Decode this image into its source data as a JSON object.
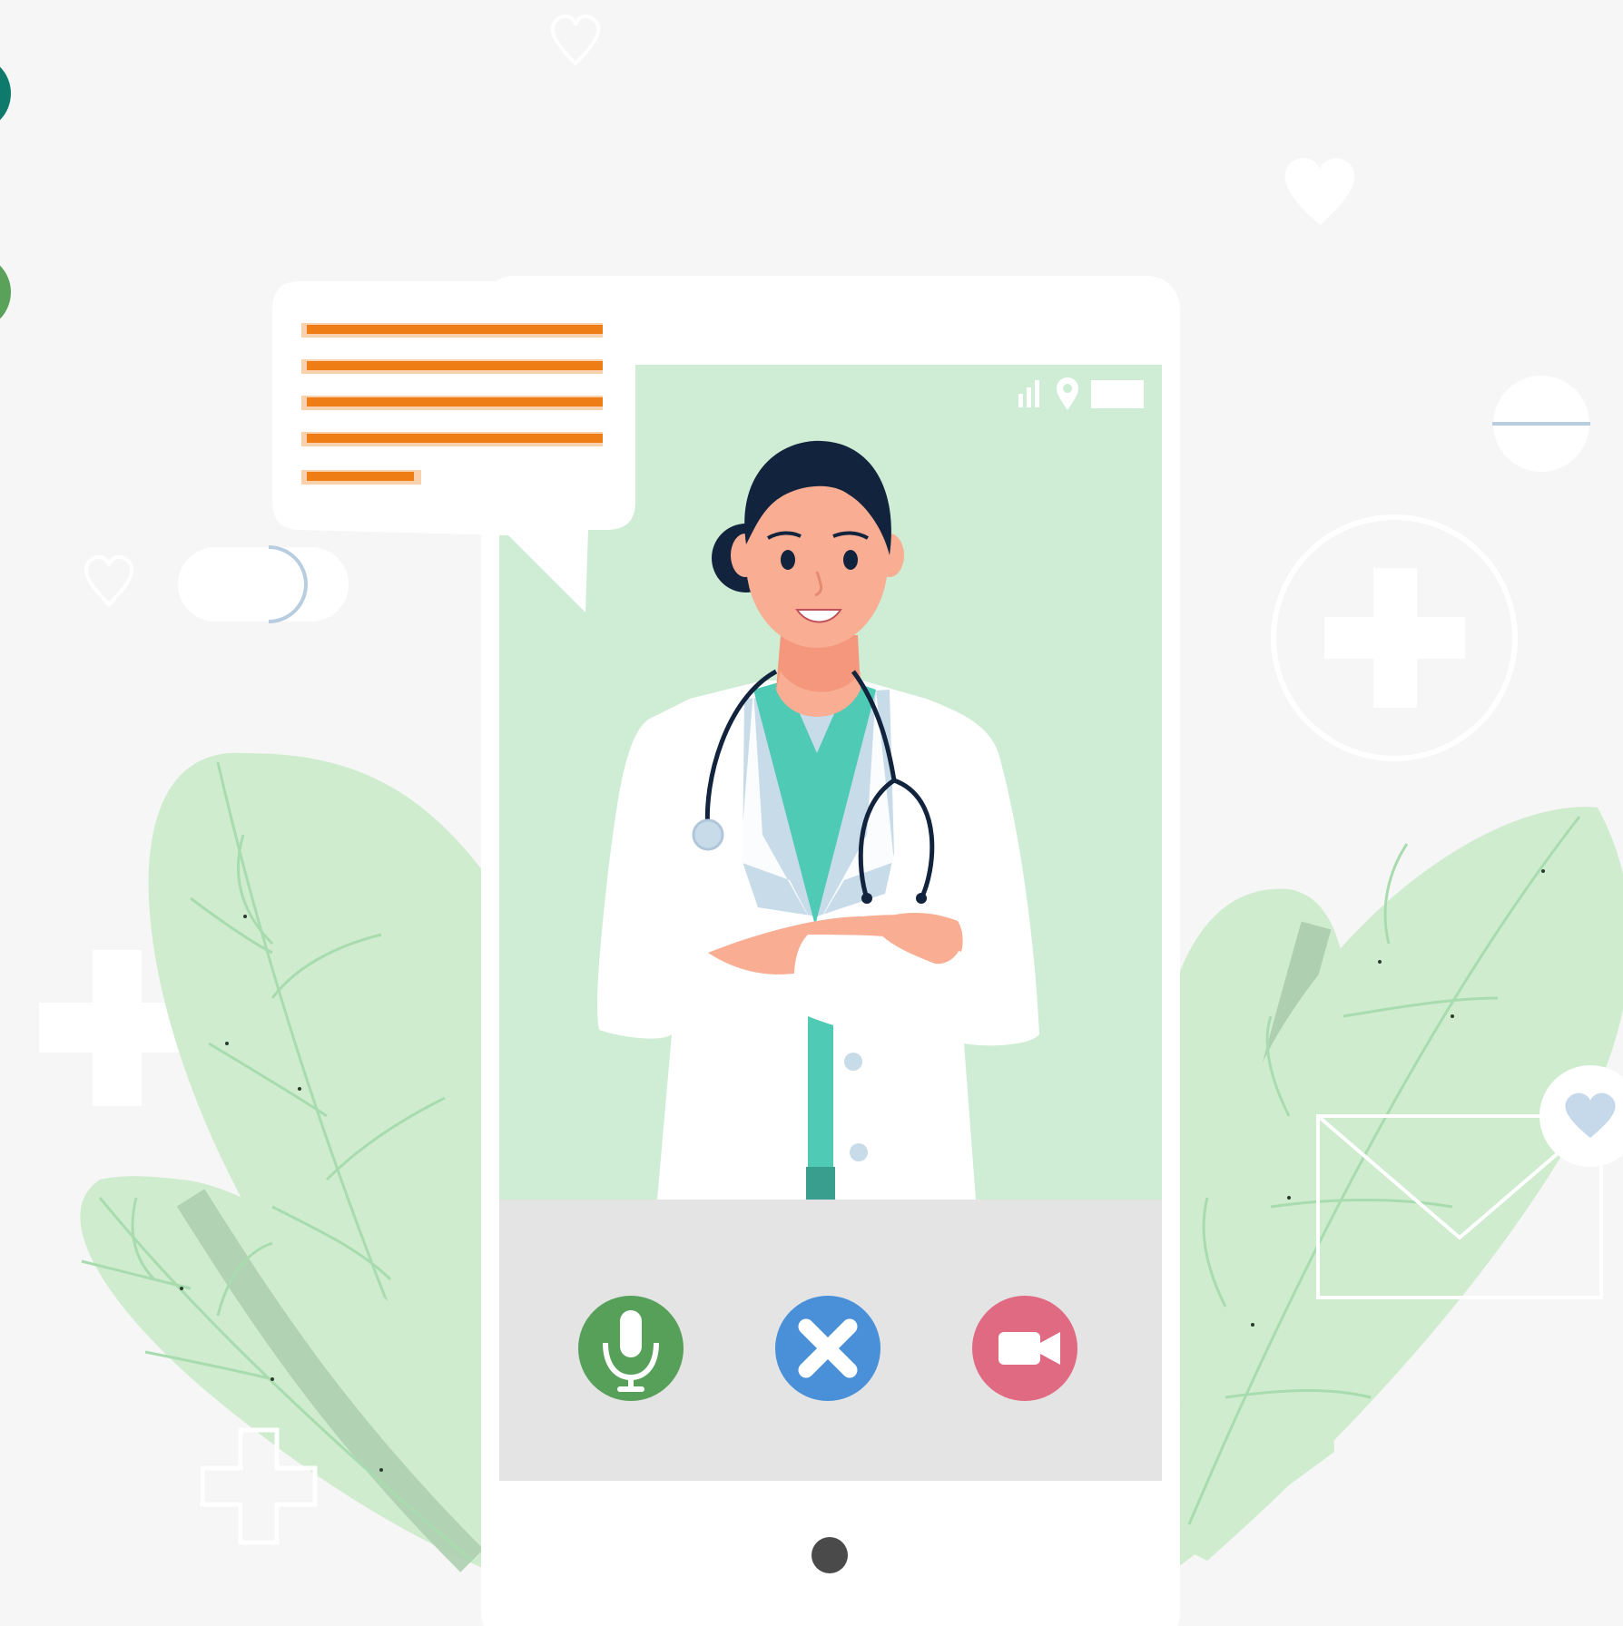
{
  "illustration": {
    "subject": "doctor-video-call",
    "status_icons": [
      "signal-icon",
      "location-pin-icon",
      "battery-icon"
    ],
    "call_controls": [
      {
        "name": "microphone-button",
        "icon": "microphone-icon",
        "color": "#57a05a"
      },
      {
        "name": "end-call-button",
        "icon": "close-icon",
        "color": "#4a90d9"
      },
      {
        "name": "video-camera-button",
        "icon": "video-camera-icon",
        "color": "#e06a82"
      }
    ],
    "decorations": [
      "heart-icon",
      "plus-cross-icon",
      "pill-icon",
      "mail-icon",
      "leaf-icon",
      "chat-bubble-icon"
    ]
  },
  "colors": {
    "background": "#f6f6f6",
    "screen_green": "#cfecd5",
    "leaf_green": "#cfeccf",
    "leaf_vein": "#a8dcaf",
    "text_lines_orange": "#ef7d15",
    "control_panel": "#e4e4e4",
    "scrubs_teal": "#4ecab5",
    "hair_navy": "#12233d",
    "skin": "#f9ad93"
  }
}
